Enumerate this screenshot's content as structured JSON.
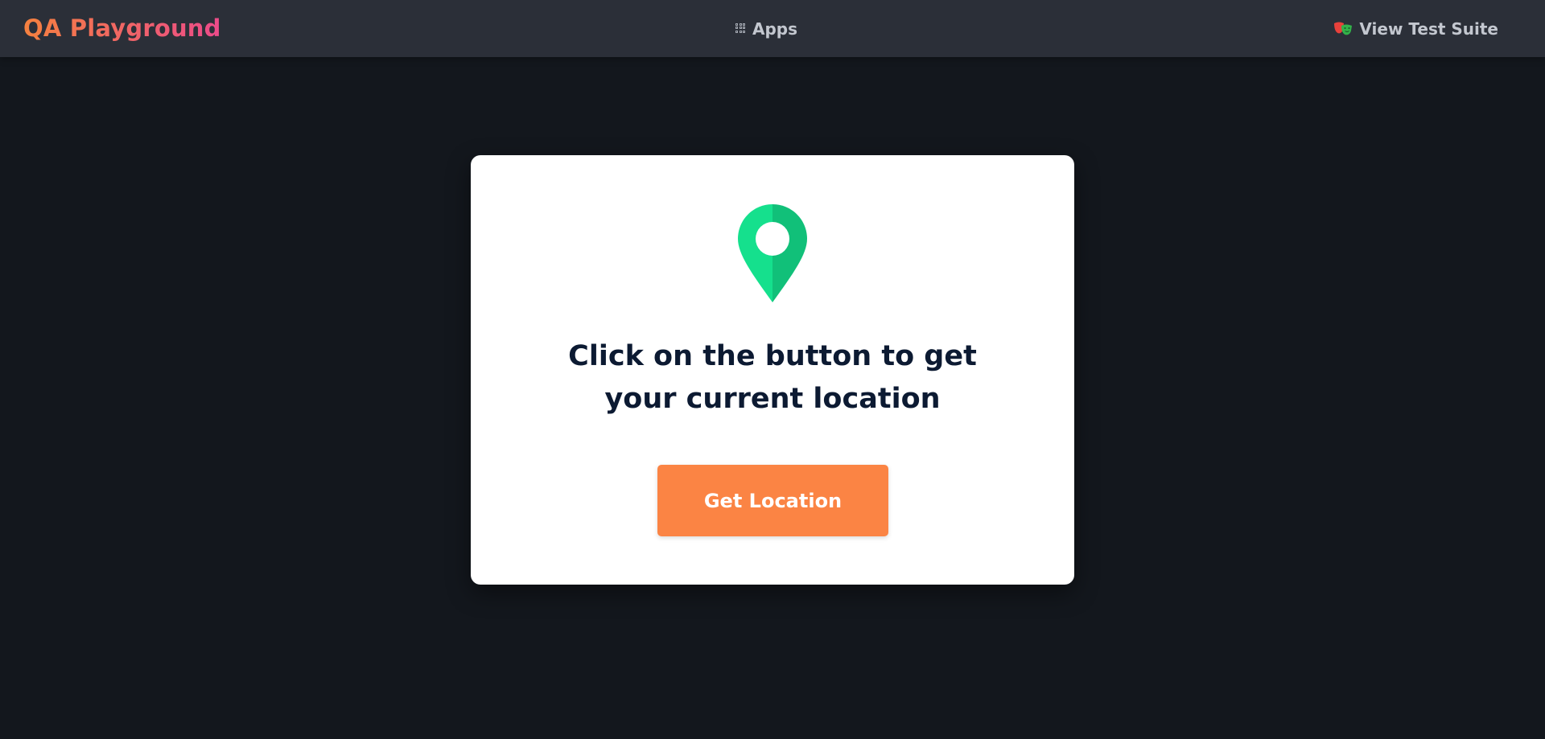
{
  "nav": {
    "brand": "QA Playground",
    "apps_label": "Apps",
    "suite_label": "View Test Suite"
  },
  "card": {
    "title": "Click on the button to get your current location",
    "button_label": "Get Location"
  },
  "colors": {
    "page_bg": "#13171d",
    "navbar_bg": "#2b2f38",
    "brand_gradient_start": "#f5813f",
    "brand_gradient_end": "#ec4b8a",
    "pin_green_light": "#15e08d",
    "pin_green_dark": "#11c079",
    "title_text": "#0c1a32",
    "button_bg": "#fb8444"
  },
  "icons": {
    "apps": "grid-icon",
    "suite": "theater-masks-icon",
    "card": "map-pin-icon"
  }
}
